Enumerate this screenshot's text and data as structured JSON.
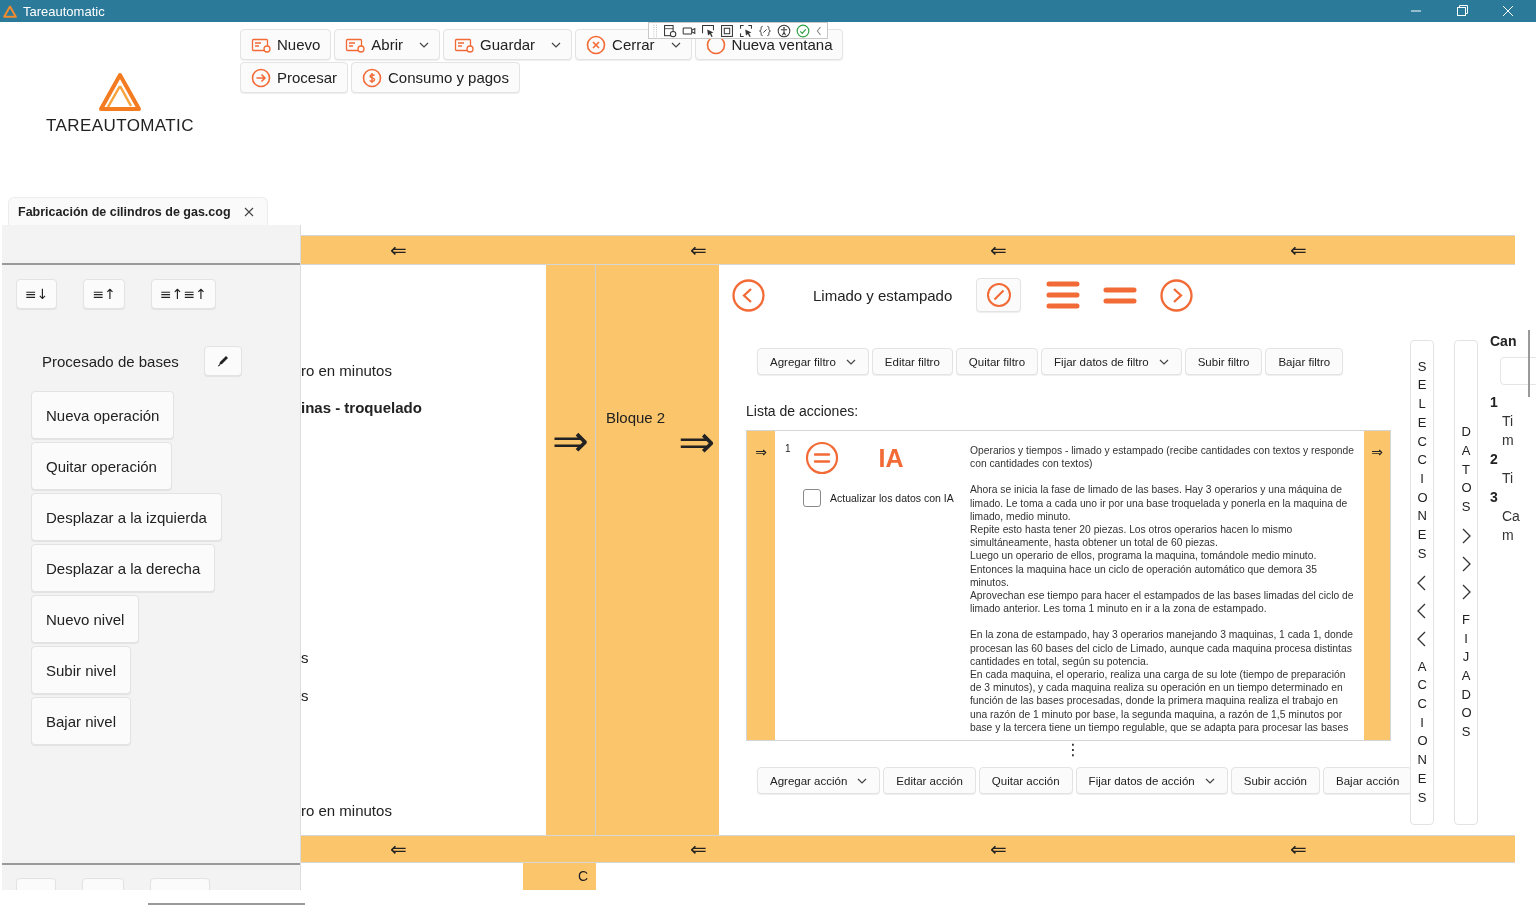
{
  "window": {
    "title": "Tareautomatic"
  },
  "logo": {
    "text": "TAREAUTOMATIC"
  },
  "toolbar": {
    "rows": [
      [
        {
          "label": "Nuevo",
          "kind": "document",
          "dropdown": false
        },
        {
          "label": "Abrir",
          "kind": "document",
          "dropdown": true
        },
        {
          "label": "Guardar",
          "kind": "document",
          "dropdown": true
        },
        {
          "label": "Cerrar",
          "kind": "close",
          "dropdown": true
        },
        {
          "label": "Nueva ventana",
          "kind": "circle",
          "dropdown": false
        }
      ],
      [
        {
          "label": "Procesar",
          "kind": "arrow",
          "dropdown": false
        },
        {
          "label": "Consumo y pagos",
          "kind": "dollar",
          "dropdown": false
        }
      ]
    ]
  },
  "tabs": [
    {
      "label": "Fabricación de cilindros de gas.cog",
      "selected": true
    }
  ],
  "left_panel": {
    "sort_buttons": [
      "≡↓",
      "≡↑",
      "≡↑≡↑"
    ],
    "title": "Procesado de bases",
    "buttons": [
      "Nueva operación",
      "Quitar operación",
      "Desplazar a la izquierda",
      "Desplazar a la derecha",
      "Nuevo nivel",
      "Subir nivel",
      "Bajar nivel"
    ]
  },
  "connector_bars": {
    "top": [
      "⇐",
      "⇐",
      "⇐",
      "⇐"
    ],
    "bottom": [
      "⇐",
      "⇐",
      "⇐",
      "⇐"
    ]
  },
  "block_texts": [
    {
      "text": "ro en minutos",
      "bold": false
    },
    {
      "text": "inas - troquelado",
      "bold": true
    },
    {
      "text": "s",
      "bold": false
    },
    {
      "text": "s",
      "bold": false
    },
    {
      "text": "ro en minutos",
      "bold": false
    }
  ],
  "flow_columns": [
    {
      "arrow": "⇒"
    },
    {
      "label": "Bloque 2",
      "arrow": "⇒"
    }
  ],
  "operation": {
    "title": "Limado y estampado",
    "filter_buttons": [
      {
        "label": "Agregar filtro",
        "dropdown": true
      },
      {
        "label": "Editar filtro",
        "dropdown": false
      },
      {
        "label": "Quitar filtro",
        "dropdown": false
      },
      {
        "label": "Fijar datos de filtro",
        "dropdown": true
      },
      {
        "label": "Subir filtro",
        "dropdown": false
      },
      {
        "label": "Bajar filtro",
        "dropdown": false
      }
    ],
    "actions_label": "Lista de acciones:",
    "actions": [
      {
        "number": "1",
        "badge": "IA",
        "arrow_in": "⇒",
        "arrow_out": "⇒",
        "checkbox": {
          "label": "Actualizar los datos con IA",
          "checked": false
        },
        "description": [
          [
            "Operarios y tiempos - limado y estampado (recibe cantidades con textos y responde con cantidades con textos)"
          ],
          [
            "Ahora se inicia la fase de limado de las bases. Hay 3 operarios y una máquina de limado. Le toma a cada uno ir por una base troquelada y ponerla en la maquina de limado, medio minuto.",
            "Repite esto hasta tener 20 piezas. Los otros operarios hacen lo mismo simultáneamente, hasta obtener un total de 60 piezas.",
            "Luego un operario de ellos, programa la maquina, tomándole medio minuto.",
            "Entonces la maquina hace un ciclo de operación automático que demora 35 minutos.",
            "Aprovechan ese tiempo para hacer el estampados de las bases limadas del ciclo de limado anterior. Les toma 1 minuto en ir a la zona de estampado."
          ],
          [
            "En la zona de estampado, hay 3 operarios manejando 3 maquinas, 1 cada 1, donde procesan las 60 bases del ciclo de Limado, aunque cada maquina procesa distintas cantidades en total, según su potencia.",
            "En cada maquina, el operario, realiza una carga de su lote (tiempo de preparación de 3 minutos), y cada maquina realiza su operación en un tiempo determinado en función de las bases procesadas, donde la primera maquina realiza el trabajo en una razón de 1 minuto por base, la segunda maquina, a razón de 1,5 minutos por base y la tercera tiene un tiempo regulable,  que se adapta para procesar las bases"
          ]
        ]
      }
    ],
    "more": "⋮",
    "action_buttons": [
      {
        "label": "Agregar acción",
        "dropdown": true
      },
      {
        "label": "Editar acción",
        "dropdown": false
      },
      {
        "label": "Quitar acción",
        "dropdown": false
      },
      {
        "label": "Fijar datos de acción",
        "dropdown": true
      },
      {
        "label": "Subir acción",
        "dropdown": false
      },
      {
        "label": "Bajar acción",
        "dropdown": false
      }
    ]
  },
  "side_tabs": [
    {
      "top": "SELECCIONES",
      "bottom": "ACCIONES",
      "kind": "left"
    },
    {
      "top": "DATOS",
      "bottom": "FIJADOS",
      "kind": "right"
    }
  ],
  "data_column": {
    "title": "Can",
    "items": [
      {
        "number": "1",
        "lines": [
          "Ti",
          "m"
        ]
      },
      {
        "number": "2",
        "lines": [
          "Ti"
        ]
      },
      {
        "number": "3",
        "lines": [
          "Ca",
          "m"
        ]
      }
    ]
  },
  "bottom_block": {
    "label": "C"
  }
}
